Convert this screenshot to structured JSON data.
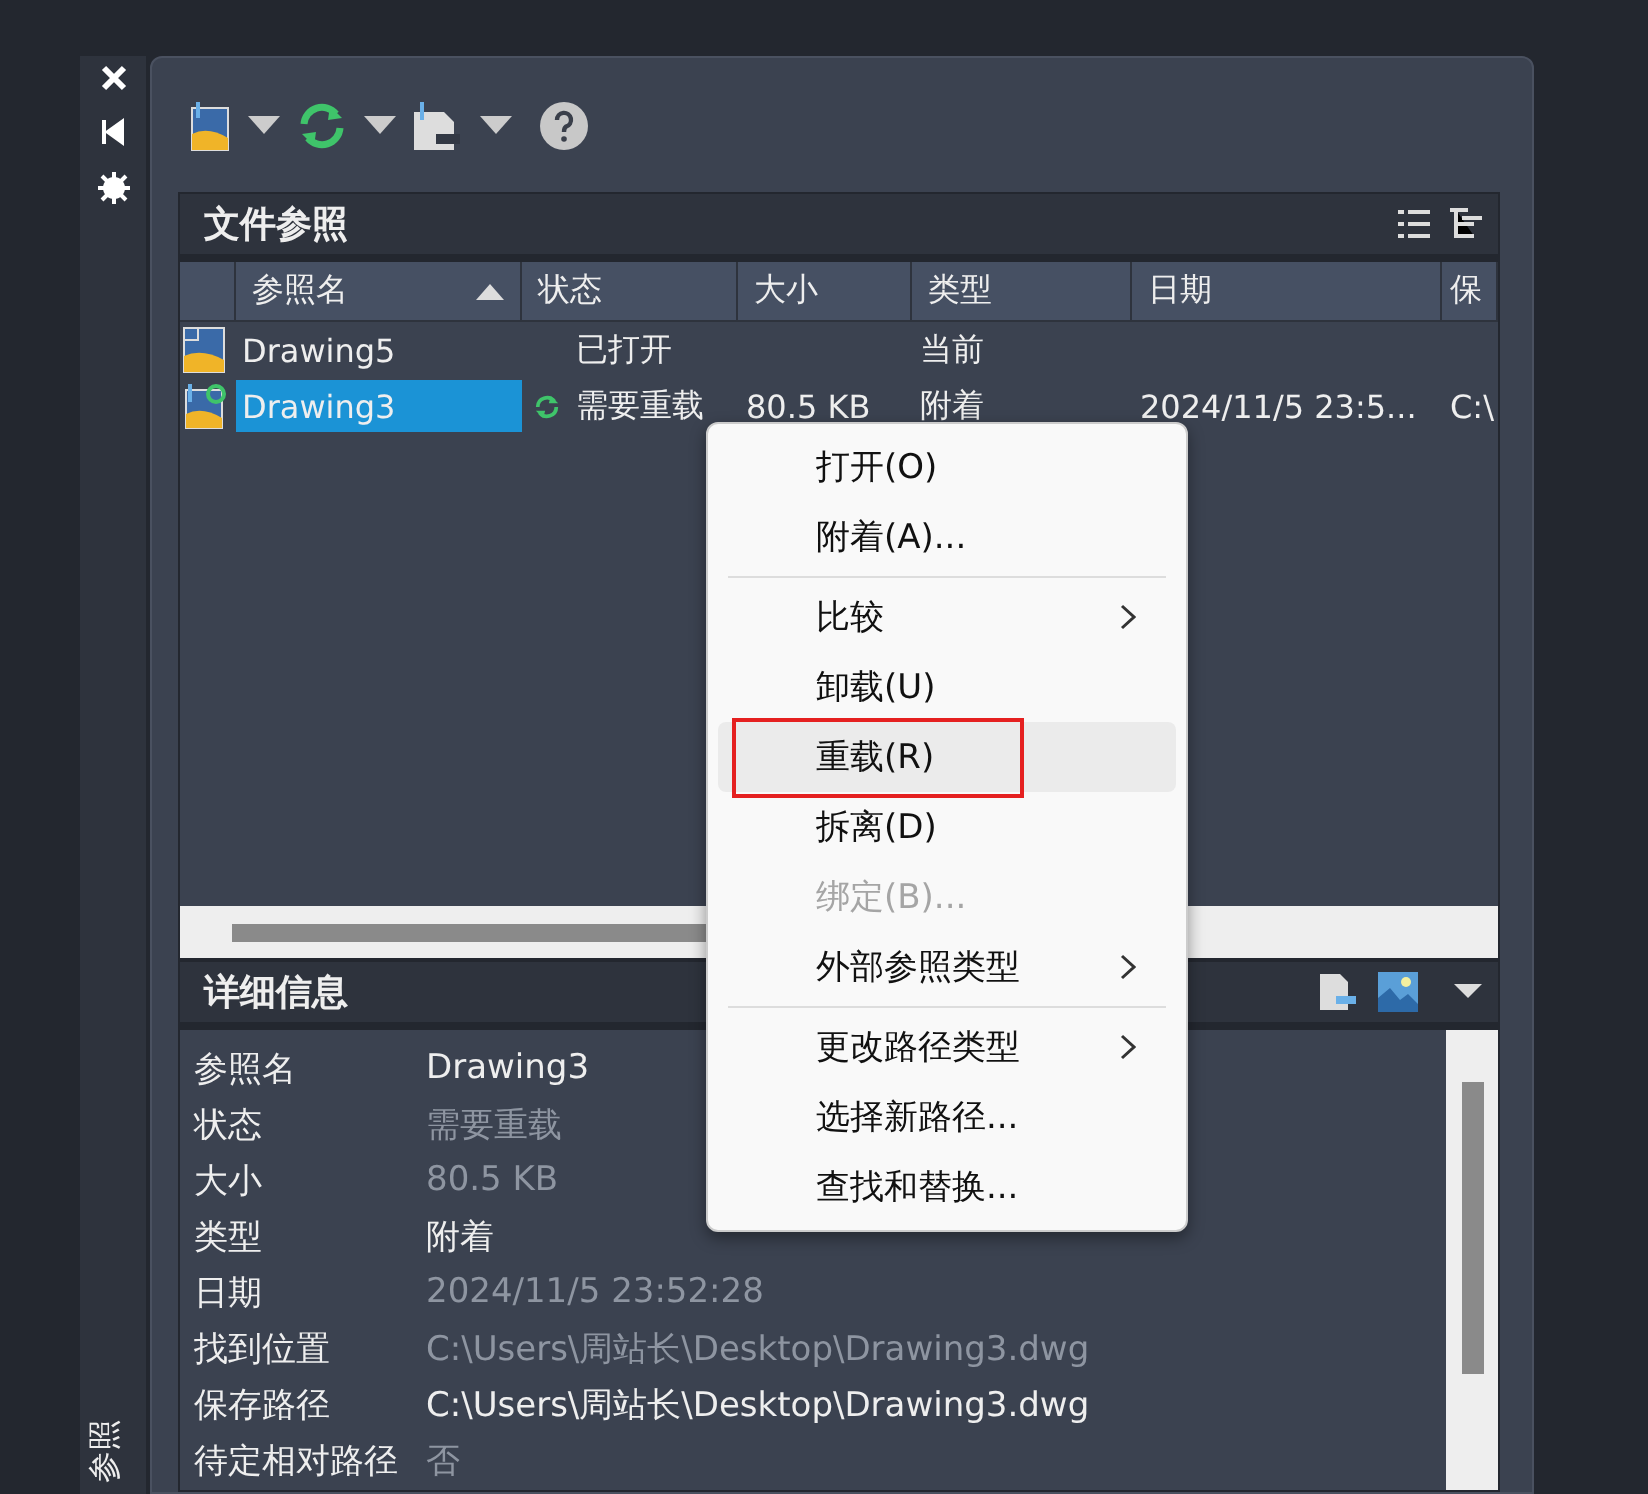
{
  "side_tab": {
    "label": "参照"
  },
  "file_references": {
    "title": "文件参照",
    "columns": [
      {
        "label": "参照名",
        "sorted": true
      },
      {
        "label": "状态",
        "sorted": false
      },
      {
        "label": "大小",
        "sorted": false
      },
      {
        "label": "类型",
        "sorted": false
      },
      {
        "label": "日期",
        "sorted": false
      },
      {
        "label": "保",
        "sorted": false
      }
    ],
    "rows": [
      {
        "kind": "current",
        "name": "Drawing5",
        "selected": false,
        "needs_reload": false,
        "status": "已打开",
        "size": "",
        "type": "当前",
        "date": "",
        "path": ""
      },
      {
        "kind": "attached",
        "name": "Drawing3",
        "selected": true,
        "needs_reload": true,
        "status": "需要重载",
        "size": "80.5 KB",
        "type": "附着",
        "date": "2024/11/5 23:5...",
        "path": "C:\\"
      }
    ]
  },
  "details": {
    "title": "详细信息",
    "properties": [
      {
        "label": "参照名",
        "value": "Drawing3",
        "dimmed": false
      },
      {
        "label": "状态",
        "value": "需要重载",
        "dimmed": true
      },
      {
        "label": "大小",
        "value": "80.5 KB",
        "dimmed": true
      },
      {
        "label": "类型",
        "value": "附着",
        "dimmed": false
      },
      {
        "label": "日期",
        "value": "2024/11/5 23:52:28",
        "dimmed": true
      },
      {
        "label": "找到位置",
        "value": "C:\\Users\\周站长\\Desktop\\Drawing3.dwg",
        "dimmed": true
      },
      {
        "label": "保存路径",
        "value": "C:\\Users\\周站长\\Desktop\\Drawing3.dwg",
        "dimmed": false
      },
      {
        "label": "待定相对路径",
        "value": "否",
        "dimmed": true
      }
    ]
  },
  "context_menu": [
    {
      "kind": "item",
      "label": "打开(O)",
      "disabled": false,
      "submenu": false,
      "hovered": false,
      "outlined": false
    },
    {
      "kind": "item",
      "label": "附着(A)...",
      "disabled": false,
      "submenu": false,
      "hovered": false,
      "outlined": false
    },
    {
      "kind": "separator"
    },
    {
      "kind": "item",
      "label": "比较",
      "disabled": false,
      "submenu": true,
      "hovered": false,
      "outlined": false
    },
    {
      "kind": "item",
      "label": "卸载(U)",
      "disabled": false,
      "submenu": false,
      "hovered": false,
      "outlined": false
    },
    {
      "kind": "item",
      "label": "重载(R)",
      "disabled": false,
      "submenu": false,
      "hovered": true,
      "outlined": true
    },
    {
      "kind": "item",
      "label": "拆离(D)",
      "disabled": false,
      "submenu": false,
      "hovered": false,
      "outlined": false
    },
    {
      "kind": "item",
      "label": "绑定(B)...",
      "disabled": true,
      "submenu": false,
      "hovered": false,
      "outlined": false
    },
    {
      "kind": "item",
      "label": "外部参照类型",
      "disabled": false,
      "submenu": true,
      "hovered": false,
      "outlined": false
    },
    {
      "kind": "separator"
    },
    {
      "kind": "item",
      "label": "更改路径类型",
      "disabled": false,
      "submenu": true,
      "hovered": false,
      "outlined": false
    },
    {
      "kind": "item",
      "label": "选择新路径...",
      "disabled": false,
      "submenu": false,
      "hovered": false,
      "outlined": false
    },
    {
      "kind": "item",
      "label": "查找和替换...",
      "disabled": false,
      "submenu": false,
      "hovered": false,
      "outlined": false
    }
  ]
}
